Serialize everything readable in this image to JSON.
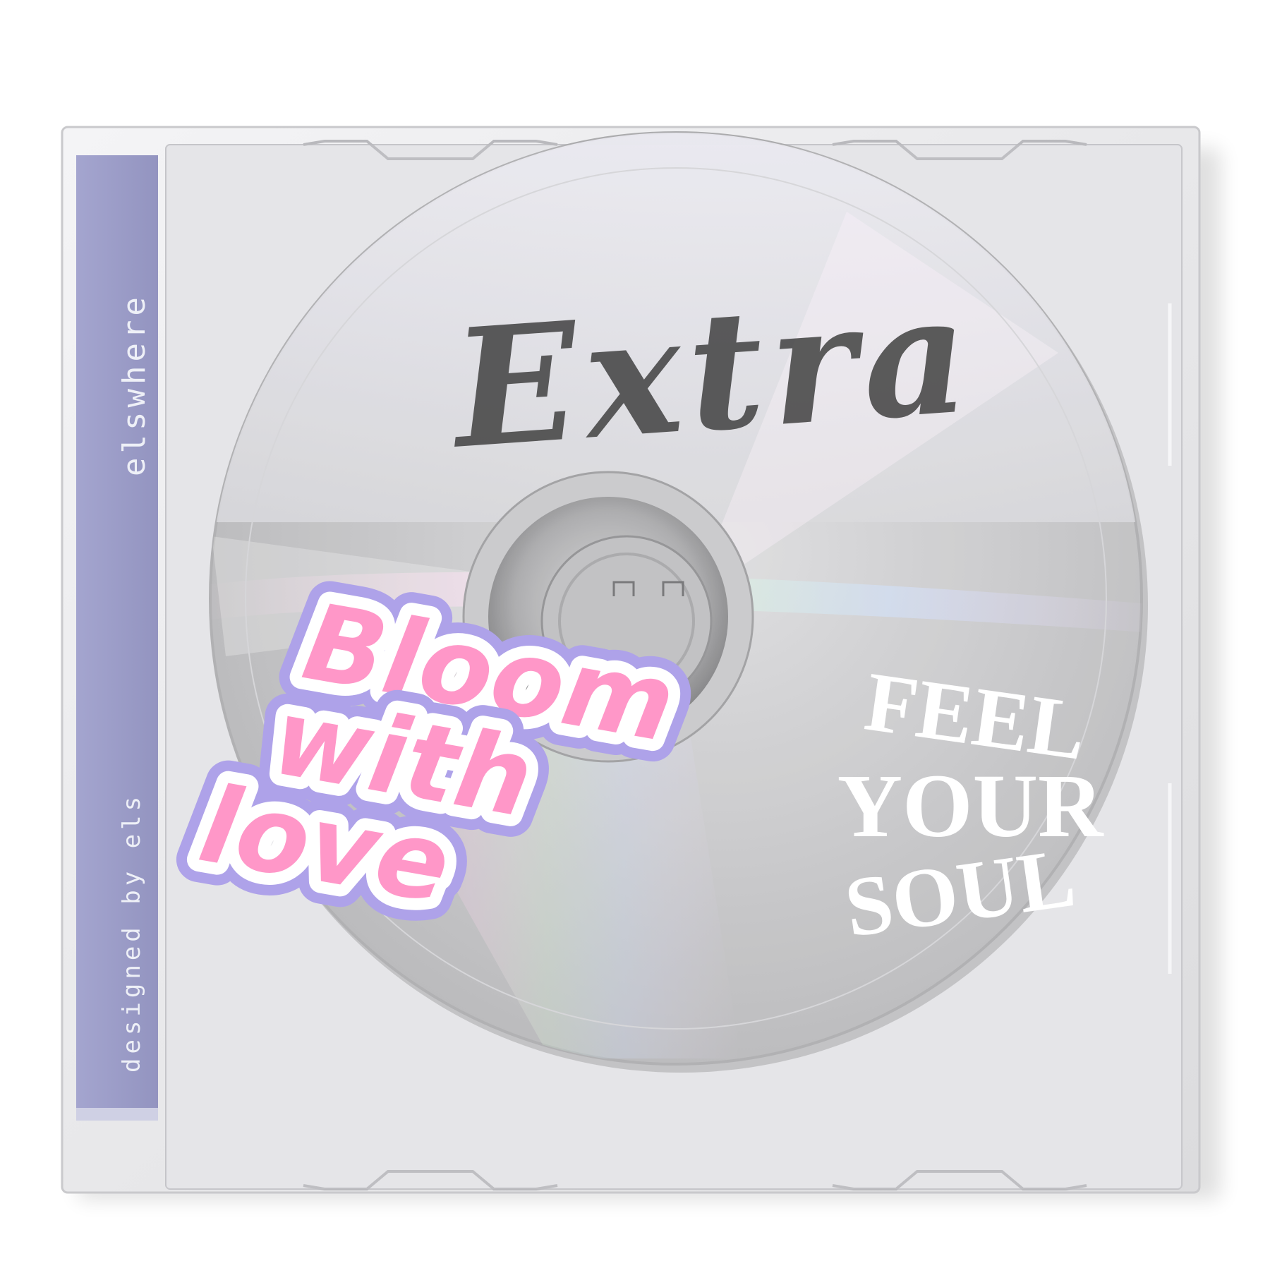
{
  "spine": {
    "title": "elswhere",
    "credit": "designed by els"
  },
  "disc": {
    "handwritten_title": "Extra"
  },
  "stickers": {
    "bloom": [
      "Bloom",
      "with",
      "love"
    ],
    "feel": [
      "FEEL",
      "YOUR",
      "SOUL"
    ]
  },
  "colors": {
    "spine": "#9b9cc8",
    "sticker_pink": "#ff8fc4",
    "sticker_outline": "#a89be8",
    "disc_silver": "#bcbcbd",
    "ink": "#2a2a2a"
  }
}
